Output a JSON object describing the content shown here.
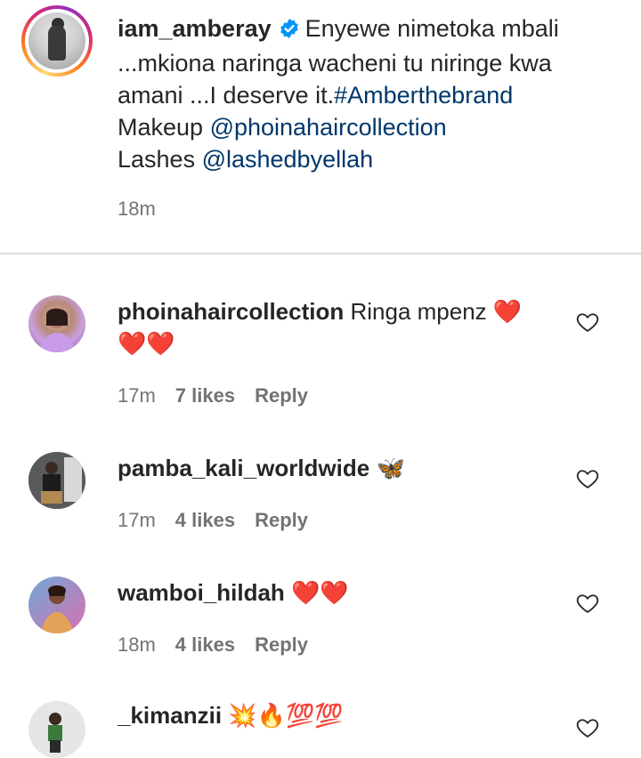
{
  "post": {
    "username": "iam_amberay",
    "verified_icon": "verified-badge-icon",
    "caption_line1": "Enyewe nimetoka mbali",
    "caption_line2": "...mkiona naringa wacheni tu niringe kwa",
    "caption_line3_text": "amani ...I deserve it.",
    "hashtag": "#Amberthebrand",
    "makeup_label": "Makeup ",
    "makeup_mention": "@phoinahaircollection",
    "lashes_label": "Lashes ",
    "lashes_mention": "@lashedbyellah",
    "time": "18m"
  },
  "comments": [
    {
      "username": "phoinahaircollection",
      "text": "Ringa mpenz",
      "emoji_line1": "❤️",
      "emoji_line2": "❤️❤️",
      "time": "17m",
      "likes": "7 likes",
      "reply": "Reply"
    },
    {
      "username": "pamba_kali_worldwide",
      "emoji": "🦋",
      "time": "17m",
      "likes": "4 likes",
      "reply": "Reply"
    },
    {
      "username": "wamboi_hildah",
      "emoji": "❤️❤️",
      "time": "18m",
      "likes": "4 likes",
      "reply": "Reply"
    },
    {
      "username": "_kimanzii",
      "emoji": "💥🔥💯💯"
    }
  ],
  "colors": {
    "text": "#262626",
    "secondary": "#737373",
    "link": "#00376b",
    "verified": "#0095f6",
    "divider": "#dbdbdb"
  }
}
